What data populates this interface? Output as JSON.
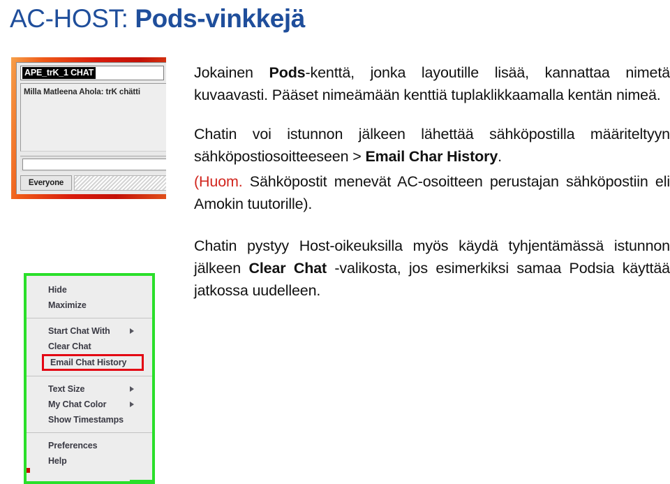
{
  "slide": {
    "title_plain": "AC-HOST: ",
    "title_bold": "Pods-vinkkejä",
    "accent_color": "#1F4E9B",
    "note_color": "#D1261E"
  },
  "chat_window": {
    "name_field_value": "APE_trK_1 CHAT",
    "message": "Milla Matleena Ahola: trK chätti",
    "input_value": "",
    "recipient_selector": "Everyone",
    "border_color": "#d81b0c"
  },
  "context_menu": {
    "border_color": "#2ADF2A",
    "highlight_color": "#E30613",
    "groups": [
      {
        "items": [
          {
            "label": "Hide",
            "submenu": false,
            "highlighted": false
          },
          {
            "label": "Maximize",
            "submenu": false,
            "highlighted": false
          }
        ]
      },
      {
        "items": [
          {
            "label": "Start Chat With",
            "submenu": true,
            "highlighted": false
          },
          {
            "label": "Clear Chat",
            "submenu": false,
            "highlighted": false
          },
          {
            "label": "Email Chat History",
            "submenu": false,
            "highlighted": true
          }
        ]
      },
      {
        "items": [
          {
            "label": "Text Size",
            "submenu": true,
            "highlighted": false
          },
          {
            "label": "My Chat Color",
            "submenu": true,
            "highlighted": false
          },
          {
            "label": "Show Timestamps",
            "submenu": false,
            "highlighted": false
          }
        ]
      },
      {
        "items": [
          {
            "label": "Preferences",
            "submenu": false,
            "highlighted": false
          },
          {
            "label": "Help",
            "submenu": false,
            "highlighted": false
          }
        ]
      }
    ]
  },
  "body": {
    "p1": {
      "a": "Jokainen ",
      "b_pods": "Pods",
      "c": "-kenttä, jonka layoutille lisää, kannattaa nimetä kuvaavasti. Pääset nimeämään kenttiä tuplaklikkaamalla kentän nimeä."
    },
    "p2": {
      "a": "Chatin voi istunnon jälkeen lähettää sähköpostilla määriteltyyn sähköpostiosoitteeseen > ",
      "b_email": "Email Char History",
      "c": "."
    },
    "p3": {
      "huom": "(Huom.",
      "rest": " Sähköpostit menevät AC-osoitteen perustajan sähköpostiin eli Amokin tuutorille)."
    },
    "p4": {
      "a": "Chatin pystyy Host-oikeuksilla myös käydä tyhjentämässä istunnon jälkeen ",
      "b_clear": "Clear Chat",
      "c": " -valikosta, jos esimerkiksi samaa Podsia käyttää jatkossa uudelleen."
    }
  }
}
